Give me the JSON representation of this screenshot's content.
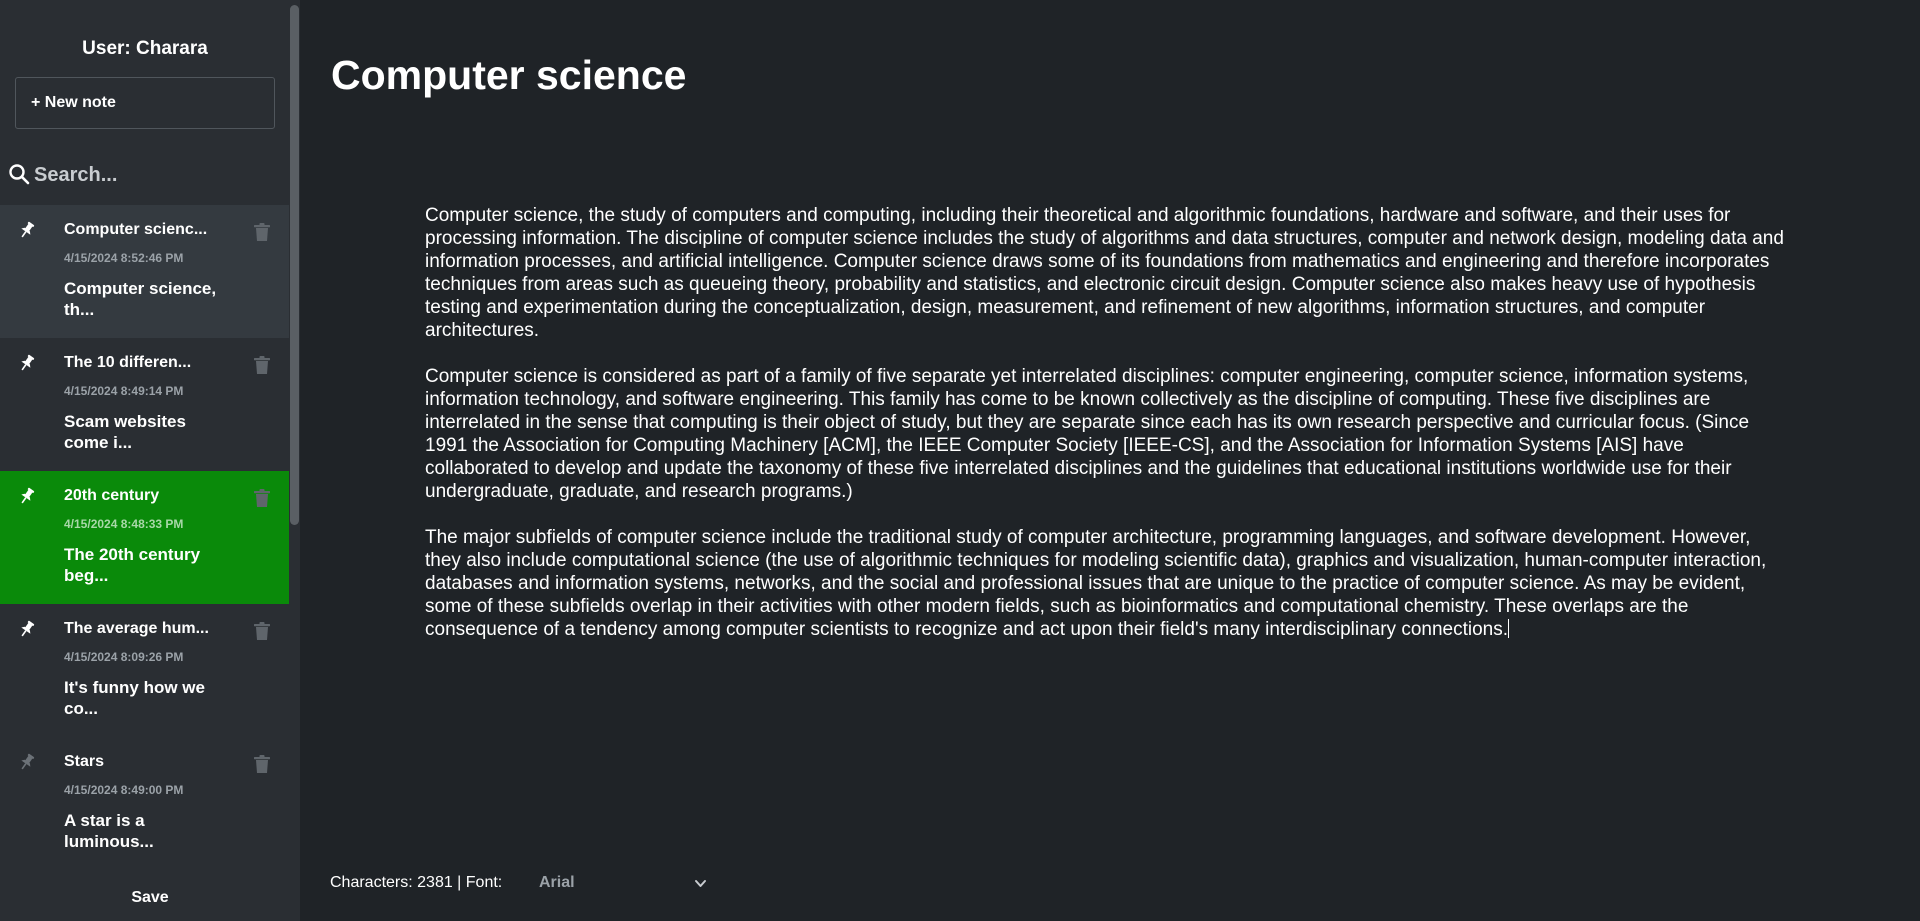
{
  "sidebar": {
    "user_label": "User: Charara",
    "new_note_label": "+ New note",
    "search_placeholder": "Search...",
    "notes": [
      {
        "title": "Computer scienc...",
        "date": "4/15/2024 8:52:46 PM",
        "preview": "Computer science, th...",
        "pinned": true,
        "state": "hover"
      },
      {
        "title": "The 10 differen...",
        "date": "4/15/2024 8:49:14 PM",
        "preview": "Scam websites come i...",
        "pinned": true,
        "state": "normal"
      },
      {
        "title": "20th century",
        "date": "4/15/2024 8:48:33 PM",
        "preview": "The 20th century beg...",
        "pinned": true,
        "state": "active"
      },
      {
        "title": "The average hum...",
        "date": "4/15/2024 8:09:26 PM",
        "preview": "It's funny how we co...",
        "pinned": true,
        "state": "normal"
      },
      {
        "title": "Stars",
        "date": "4/15/2024 8:49:00 PM",
        "preview": "A star is a luminous...",
        "pinned": false,
        "state": "normal"
      }
    ],
    "save_label": "Save",
    "icons": {
      "pin": "pin-icon",
      "trash": "trash-icon",
      "search": "search-icon"
    }
  },
  "document": {
    "title": "Computer science",
    "paragraphs": [
      "Computer science, the study of computers and computing, including their theoretical and algorithmic foundations, hardware and software, and their uses for processing information. The discipline of computer science includes the study of algorithms and data structures, computer and network design, modeling data and information processes, and artificial intelligence. Computer science draws some of its foundations from mathematics and engineering and therefore incorporates techniques from areas such as queueing theory, probability and statistics, and electronic circuit design. Computer science also makes heavy use of hypothesis testing and experimentation during the conceptualization, design, measurement, and refinement of new algorithms, information structures, and computer architectures.",
      "Computer science is considered as part of a family of five separate yet interrelated disciplines: computer engineering, computer science, information systems, information technology, and software engineering. This family has come to be known collectively as the discipline of computing. These five disciplines are interrelated in the sense that computing is their object of study, but they are separate since each has its own research perspective and curricular focus. (Since 1991 the Association for Computing Machinery [ACM], the IEEE Computer Society [IEEE-CS], and the Association for Information Systems [AIS] have collaborated to develop and update the taxonomy of these five interrelated disciplines and the guidelines that educational institutions worldwide use for their undergraduate, graduate, and research programs.)",
      "The major subfields of computer science include the traditional study of computer architecture, programming languages, and software development. However, they also include computational science (the use of algorithmic techniques for modeling scientific data), graphics and visualization, human-computer interaction, databases and information systems, networks, and the social and professional issues that are unique to the practice of computer science. As may be evident, some of these subfields overlap in their activities with other modern fields, such as bioinformatics and computational chemistry. These overlaps are the consequence of a tendency among computer scientists to recognize and act upon their field's many interdisciplinary connections."
    ]
  },
  "status": {
    "text": "Characters: 2381 | Font:",
    "font_value": "Arial"
  },
  "colors": {
    "background": "#1f2327",
    "sidebar": "#2a2e33",
    "active_note": "#0a8a0a",
    "hover_note": "#343a40"
  }
}
